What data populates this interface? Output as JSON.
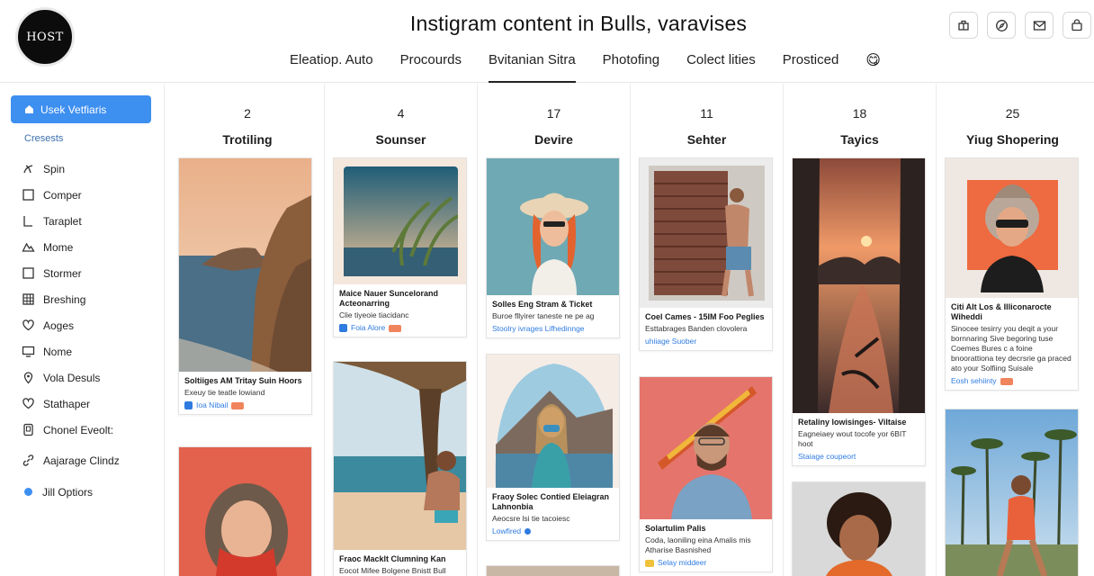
{
  "header": {
    "logo_text": "HOST",
    "title": "Instigram content in Bulls, varavises",
    "tabs": [
      {
        "label": "Eleatiop. Auto"
      },
      {
        "label": "Procourds"
      },
      {
        "label": "Bvitanian Sitra",
        "active": true
      },
      {
        "label": "Photofing"
      },
      {
        "label": "Colect lities"
      },
      {
        "label": "Prosticed"
      }
    ],
    "emoji": "😋",
    "icons": [
      "store-icon",
      "compass-icon",
      "mail-icon",
      "bag-icon"
    ]
  },
  "sidebar": {
    "primary_label": "Usek Vetfiaris",
    "section_label": "Cresests",
    "items": [
      {
        "label": "Spin",
        "icon": "spin-icon"
      },
      {
        "label": "Comper",
        "icon": "square-icon"
      },
      {
        "label": "Taraplet",
        "icon": "bracket-icon"
      },
      {
        "label": "Mome",
        "icon": "mountain-icon"
      },
      {
        "label": "Stormer",
        "icon": "square-icon"
      },
      {
        "label": "Breshing",
        "icon": "grid-icon"
      },
      {
        "label": "Aoges",
        "icon": "heart-icon"
      },
      {
        "label": "Nome",
        "icon": "monitor-icon"
      },
      {
        "label": "Vola Desuls",
        "icon": "pin-icon"
      },
      {
        "label": "Stathaper",
        "icon": "heart-icon"
      },
      {
        "label": "Chonel Eveolt:",
        "icon": "device-icon"
      },
      {
        "label": "Aajarage Clindz",
        "icon": "link-icon"
      },
      {
        "label": "Jill Optiors",
        "icon": "dot-icon"
      }
    ]
  },
  "columns": [
    {
      "count": "2",
      "name": "Trotiling",
      "cards": [
        {
          "title": "Soltiiges AM Tritay Suin Hoors",
          "text": "Exeuy tie teatle lowiand",
          "meta": "Ioa Nibail"
        },
        {
          "title": "",
          "text": "",
          "meta": ""
        }
      ]
    },
    {
      "count": "4",
      "name": "Sounser",
      "cards": [
        {
          "title": "Maice Nauer Suncelorand Acteonarring",
          "text": "Clie tiyeoie tiacidanc",
          "meta": "Foia Alore"
        },
        {
          "title": "Fraoc Macklt Clumning Kan",
          "text": "Eocot Mifee Bolgene Bnistt Bull",
          "meta": ""
        }
      ]
    },
    {
      "count": "17",
      "name": "Devire",
      "cards": [
        {
          "title": "Solles Eng Stram & Ticket",
          "text": "Buroe fllyirer taneste ne pe ag",
          "meta": "Stoolry ivrages Lifhedinnge"
        },
        {
          "title": "Fraoy Solec Contied Eleiagran Lahnonbia",
          "text": "Aeocsre lsi tie tacoiesc",
          "meta": "Lowfired"
        }
      ]
    },
    {
      "count": "11",
      "name": "Sehter",
      "cards": [
        {
          "title": "Coel Cames - 15IM Foo Peglies",
          "text": "Esttabrages Banden clovolera",
          "meta": "uhiiage Suober"
        },
        {
          "title": "Solartulim Palis",
          "text": "Coda, laoniling eina Amalis mis Atharise Basnished",
          "meta": "Selay middeer"
        }
      ]
    },
    {
      "count": "18",
      "name": "Tayics",
      "cards": [
        {
          "title": "Retaliny lowisinges- Viltaise",
          "text": "Eagneiaey wout tocofe yor 6BIT hoot",
          "meta": "Staiage coupeort"
        },
        {
          "title": "",
          "text": "",
          "meta": ""
        }
      ]
    },
    {
      "count": "25",
      "name": "Yiug Shopering",
      "cards": [
        {
          "title": "Citi Alt Los & Illiconarocte Wiheddi",
          "text": "Sinocee tesirry you deqit a your bornnaring Sive begoring tuse Coemes Bures c a foine bnoorattiona tey decrsrie ga praced ato your Solfiing Suisale",
          "meta": "Eosh sehiinty"
        },
        {
          "title": "",
          "text": "",
          "meta": ""
        }
      ]
    }
  ]
}
